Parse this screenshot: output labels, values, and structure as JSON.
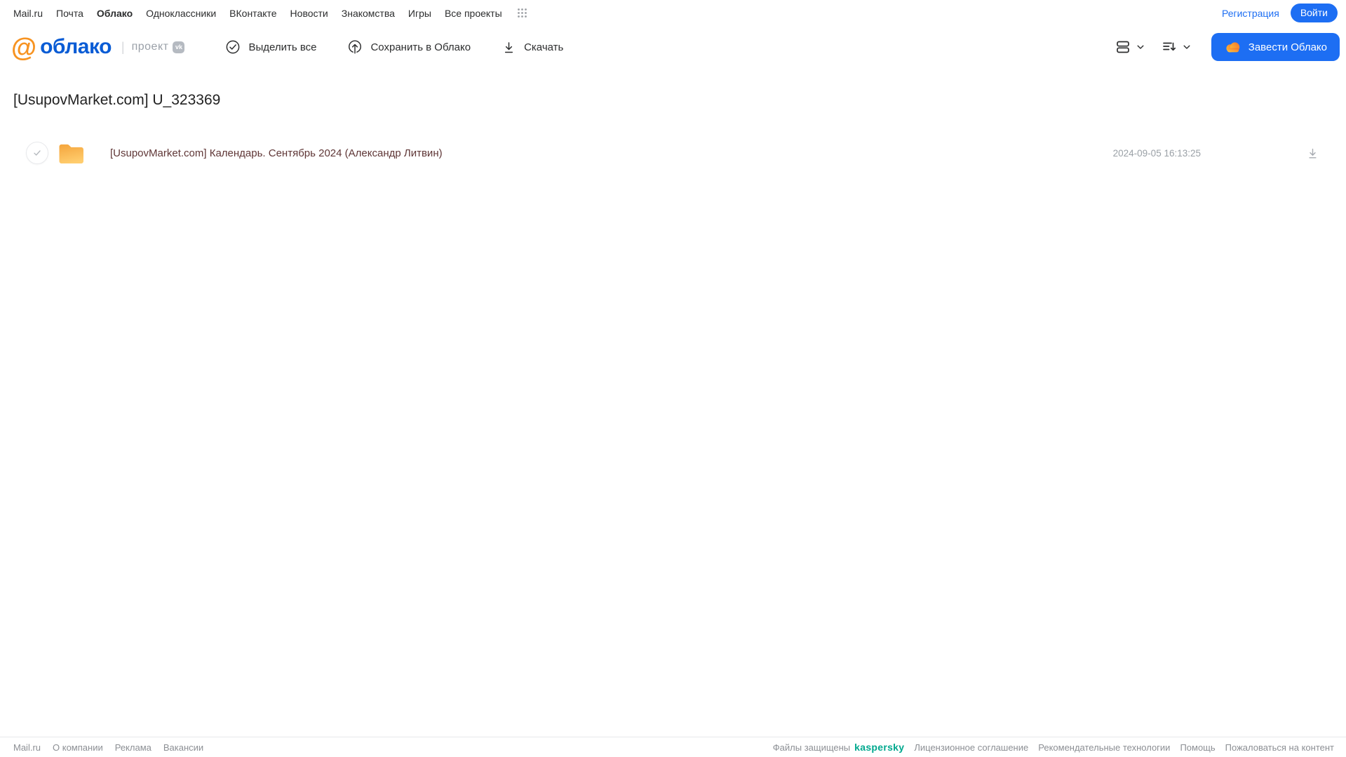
{
  "topnav": {
    "items": [
      "Mail.ru",
      "Почта",
      "Облако",
      "Одноклассники",
      "ВКонтакте",
      "Новости",
      "Знакомства",
      "Игры",
      "Все проекты"
    ],
    "registration": "Регистрация",
    "login": "Войти"
  },
  "header": {
    "brand": "облако",
    "at_glyph": "@",
    "project_label": "проект",
    "vk_badge": "vk",
    "toolbar": {
      "select_all": "Выделить все",
      "save_to_cloud": "Сохранить в Облако",
      "download": "Скачать"
    },
    "cta": "Завести Облако"
  },
  "page": {
    "title": "[UsupovMarket.com] U_323369"
  },
  "files": [
    {
      "name": "[UsupovMarket.com] Календарь. Сентябрь 2024 (Александр Литвин)",
      "modified": "2024-09-05 16:13:25"
    }
  ],
  "footer": {
    "left": [
      "Mail.ru",
      "О компании",
      "Реклама",
      "Вакансии"
    ],
    "protected_label": "Файлы защищены",
    "kaspersky": "kaspersky",
    "links": [
      "Лицензионное соглашение",
      "Рекомендательные технологии",
      "Помощь",
      "Пожаловаться на контент"
    ]
  },
  "colors": {
    "accent_blue": "#1d6ef3",
    "brand_blue": "#0a5cd5",
    "brand_orange": "#f79321",
    "kaspersky_teal": "#00a88e",
    "folder_top": "#f6a53c",
    "folder_bottom": "#ffcd6e",
    "visited_link": "#5f3636"
  }
}
